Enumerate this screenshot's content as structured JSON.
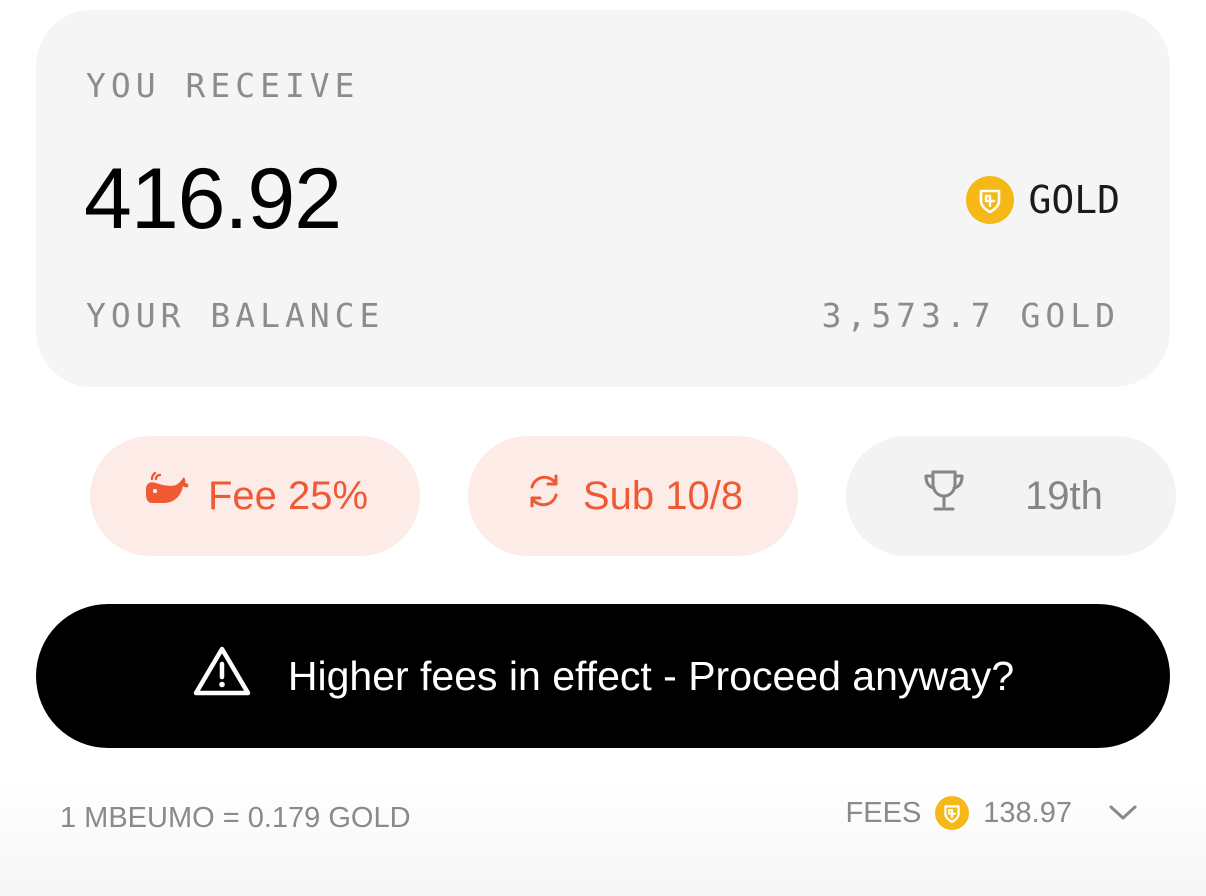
{
  "receive": {
    "label": "YOU RECEIVE",
    "amount": "416.92",
    "token": {
      "name": "GOLD",
      "icon": "gold-token-icon",
      "color": "#f5b817"
    },
    "balance_label": "YOUR BALANCE",
    "balance_value": "3,573.7 GOLD"
  },
  "pills": {
    "fee": {
      "icon": "whale-icon",
      "label": "Fee 25%",
      "color": "#ef5a34"
    },
    "sub": {
      "icon": "refresh-icon",
      "label": "Sub 10/8",
      "color": "#ef5a34"
    },
    "rank": {
      "icon": "trophy-icon",
      "label": "19th"
    }
  },
  "warning": {
    "icon": "warning-triangle-icon",
    "label": "Higher fees in effect - Proceed anyway?"
  },
  "footer": {
    "rate": "1 MBEUMO = 0.179 GOLD",
    "fees_label": "FEES",
    "fees_value": "138.97",
    "expand_icon": "chevron-down-icon"
  }
}
